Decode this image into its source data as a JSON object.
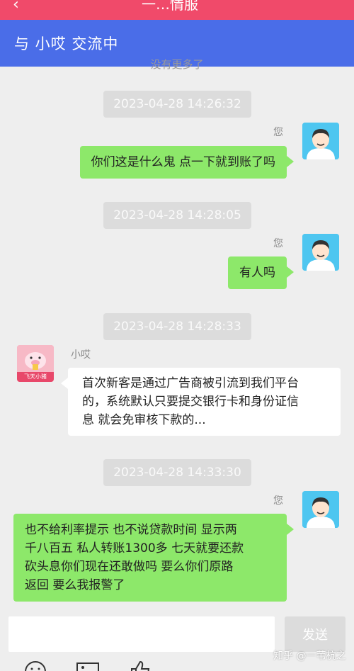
{
  "topbar": {
    "back": "‹",
    "title": "一…情服"
  },
  "header": {
    "title": "与 小哎 交流中"
  },
  "history": {
    "more": "没有更多了"
  },
  "messages": [
    {
      "time": "2023-04-28 14:26:32",
      "sender": "您",
      "text": "你们这是什么鬼 点一下就到账了吗"
    },
    {
      "time": "2023-04-28 14:28:05",
      "sender": "您",
      "text": "有人吗"
    },
    {
      "time": "2023-04-28 14:28:33",
      "sender": "小哎",
      "lines": [
        "首次新客是通过广告商被引流到我们平台",
        "的，系统默认只要提交银行卡和身份证信",
        "息 就会免审核下款的..."
      ]
    },
    {
      "time": "2023-04-28 14:33:30",
      "sender": "您",
      "lines": [
        "也不给利率提示 也不说贷款时间 显示两",
        "千八百五 私人转账1300多 七天就要还款",
        "砍头息你们现在还敢做吗 要么你们原路",
        "返回 要么我报警了"
      ]
    }
  ],
  "bot_avatar": {
    "label": "飞天小猪"
  },
  "input": {
    "value": "",
    "placeholder": ""
  },
  "send": {
    "label": "发送"
  },
  "watermark": "知乎 @一苇杭之",
  "tools": {
    "emoji": "smile-icon",
    "image": "image-icon",
    "like": "thumbs-up-icon"
  },
  "colors": {
    "topbar": "#f04a6a",
    "header": "#4a6de8",
    "me_bubble": "#8de86a",
    "user_avatar": "#4ec6f0"
  }
}
